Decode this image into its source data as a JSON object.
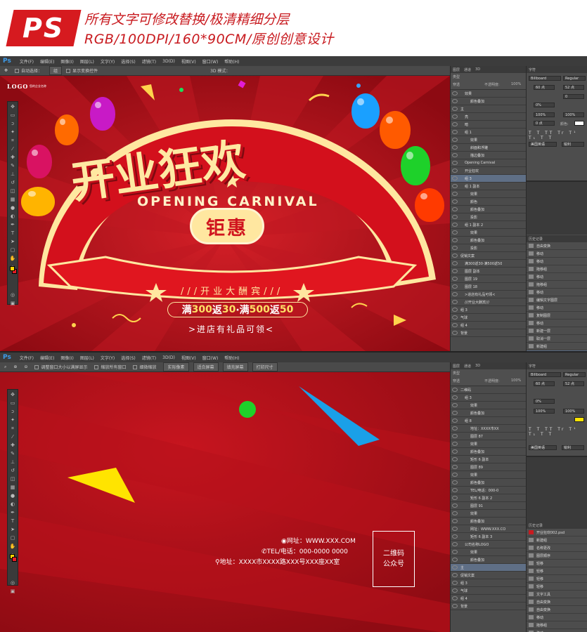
{
  "banner": {
    "badge": "PS",
    "line1": "所有文字可修改替换/极清精细分层",
    "line2": "RGB/100DPI/160*90CM/原创创意设计"
  },
  "menu": [
    "文件(F)",
    "编辑(E)",
    "图像(I)",
    "图层(L)",
    "文字(Y)",
    "选择(S)",
    "滤镜(T)",
    "3D(D)",
    "视图(V)",
    "窗口(W)",
    "帮助(H)"
  ],
  "window1": {
    "options": {
      "auto_select": "自动选择：",
      "group": "组",
      "show_transform": "显示变换控件",
      "mode3d": "3D 模式："
    },
    "poster": {
      "logo": "LOGO",
      "logo_sub": "您的企业名称",
      "title": "开业狂欢",
      "subtitle": "OPENING CARNIVAL",
      "badge": "钜惠",
      "line_celebrate": "///开业大酬宾///",
      "promo_prefix1": "满",
      "promo_num1": "300",
      "promo_mid1": "返",
      "promo_num2": "30",
      "promo_dot": "·满",
      "promo_num3": "500",
      "promo_mid2": "返",
      "promo_num4": "50",
      "line_gift": ">进店有礼品可领<"
    },
    "layers_tabs": [
      "图层",
      "通道",
      "3D"
    ],
    "layers_kind": "类型",
    "blend_mode": "穿透",
    "opacity_label": "不透明度:",
    "opacity": "100%",
    "fill_label": "填充:",
    "fill": "100%",
    "layers": [
      {
        "name": "效果",
        "indent": 1
      },
      {
        "name": "颜色叠加",
        "indent": 2
      },
      {
        "name": "主",
        "indent": 0
      },
      {
        "name": "亮",
        "indent": 1
      },
      {
        "name": "暗",
        "indent": 1
      },
      {
        "name": "组 1",
        "indent": 1
      },
      {
        "name": "效果",
        "indent": 2
      },
      {
        "name": "斜面和浮雕",
        "indent": 2
      },
      {
        "name": "描边叠加",
        "indent": 2
      },
      {
        "name": "Opening Carnival",
        "indent": 1
      },
      {
        "name": "开业狂欢",
        "indent": 1
      },
      {
        "name": "组 3",
        "indent": 1,
        "selected": true
      },
      {
        "name": "组 1 副本",
        "indent": 1
      },
      {
        "name": "效果",
        "indent": 2
      },
      {
        "name": "颜色",
        "indent": 2
      },
      {
        "name": "颜色叠加",
        "indent": 2
      },
      {
        "name": "投影",
        "indent": 2
      },
      {
        "name": "组 1 副本 2",
        "indent": 1
      },
      {
        "name": "效果",
        "indent": 2
      },
      {
        "name": "颜色叠加",
        "indent": 2
      },
      {
        "name": "投影",
        "indent": 2
      },
      {
        "name": "促销文案",
        "indent": 0
      },
      {
        "name": "满300返30·满500返50",
        "indent": 1
      },
      {
        "name": "图层 副本",
        "indent": 1
      },
      {
        "name": "图层 19",
        "indent": 1
      },
      {
        "name": "图层 18",
        "indent": 1
      },
      {
        "name": ">进店有礼品可领<",
        "indent": 1
      },
      {
        "name": "///开业大酬宾///",
        "indent": 1
      },
      {
        "name": "组 3",
        "indent": 0
      },
      {
        "name": "气球",
        "indent": 0
      },
      {
        "name": "组 4",
        "indent": 0
      },
      {
        "name": "背景",
        "indent": 0
      }
    ],
    "character": {
      "tab": "字符",
      "font": "Billboard",
      "style": "Regular",
      "size": "60 点",
      "leading": "52 点",
      "kerning": "0",
      "tracking": "0%",
      "scale_v": "100%",
      "scale_h": "100%",
      "baseline": "0 点",
      "color_label": "颜色:",
      "lang": "美国英语",
      "aa": "锐利"
    },
    "history": {
      "tab": "历史记录",
      "items": [
        "自由变换",
        "移动",
        "移动",
        "拖移组",
        "移动",
        "拖移组",
        "移动",
        "编辑文字图层",
        "移动",
        "复制图层",
        "移动",
        "新建一层",
        "取消一层",
        "新建组",
        "图层顺序"
      ]
    }
  },
  "window2": {
    "options": {
      "fit_all": "调整窗口大小以满屏显示",
      "zoom_all": "缩放所有窗口",
      "scrubby": "细微缩放",
      "actual": "实际像素",
      "fit": "适合屏幕",
      "fill": "填充屏幕",
      "print": "打印尺寸"
    },
    "poster": {
      "web": "网址：WWW.XXX.COM",
      "tel": "TEL/电话：000-0000 0000",
      "addr": "地址：XXXX市XXXX路XXX号XXX座XX室",
      "qr1": "二维码",
      "qr2": "公众号"
    },
    "layers": [
      {
        "name": "二维码",
        "indent": 0
      },
      {
        "name": "组 3",
        "indent": 1
      },
      {
        "name": "效果",
        "indent": 2
      },
      {
        "name": "颜色叠加",
        "indent": 2
      },
      {
        "name": "组 8",
        "indent": 1
      },
      {
        "name": "地址：XXXX市XX",
        "indent": 2
      },
      {
        "name": "图层 87",
        "indent": 2
      },
      {
        "name": "效果",
        "indent": 2
      },
      {
        "name": "颜色叠加",
        "indent": 2
      },
      {
        "name": "矩形 6 副本",
        "indent": 2
      },
      {
        "name": "图层 89",
        "indent": 2
      },
      {
        "name": "效果",
        "indent": 2
      },
      {
        "name": "颜色叠加",
        "indent": 2
      },
      {
        "name": "TEL/电话：000-0",
        "indent": 2
      },
      {
        "name": "矩形 6 副本 2",
        "indent": 2
      },
      {
        "name": "图层 91",
        "indent": 2
      },
      {
        "name": "效果",
        "indent": 2
      },
      {
        "name": "颜色叠加",
        "indent": 2
      },
      {
        "name": "网址：WWW.XXX.CO",
        "indent": 2
      },
      {
        "name": "矩形 6 副本 3",
        "indent": 2
      },
      {
        "name": "公司名称LOGO",
        "indent": 1
      },
      {
        "name": "效果",
        "indent": 2
      },
      {
        "name": "颜色叠加",
        "indent": 2
      },
      {
        "name": "主",
        "indent": 0,
        "selected": true
      },
      {
        "name": "促销文案",
        "indent": 0
      },
      {
        "name": "组 3",
        "indent": 0
      },
      {
        "name": "气球",
        "indent": 0
      },
      {
        "name": "组 4",
        "indent": 0
      },
      {
        "name": "背景",
        "indent": 0
      }
    ],
    "history": {
      "tab": "历史记录",
      "doc": "开业狂欢002.psd",
      "items": [
        "新建组",
        "名称更改",
        "图层顺序",
        "轻移",
        "轻移",
        "轻移",
        "轻移",
        "文字工具",
        "自由变换",
        "自由变换",
        "移动",
        "拖移组",
        "移动",
        "移动",
        "移动",
        "拖移组"
      ]
    }
  }
}
